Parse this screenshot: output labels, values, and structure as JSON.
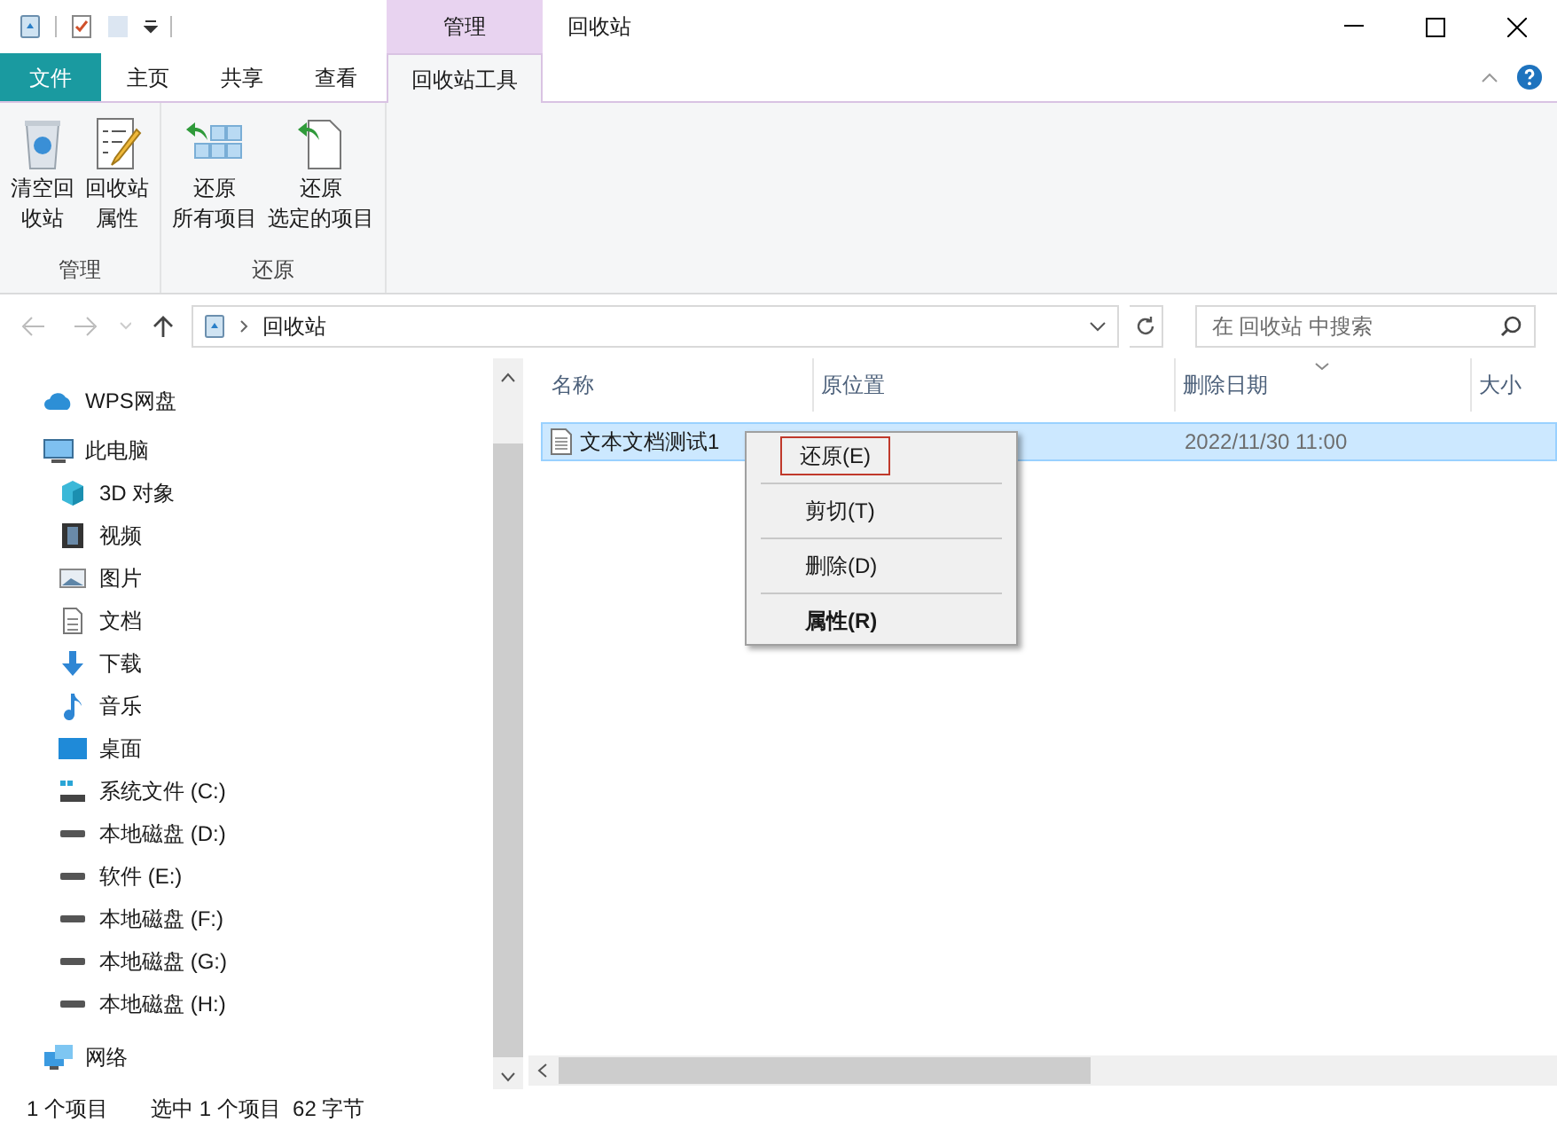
{
  "window": {
    "title": "回收站",
    "contextual_group": "管理"
  },
  "tabs": [
    {
      "label": "文件",
      "kind": "file",
      "selected": false
    },
    {
      "label": "主页",
      "kind": "normal",
      "selected": false
    },
    {
      "label": "共享",
      "kind": "normal",
      "selected": false
    },
    {
      "label": "查看",
      "kind": "normal",
      "selected": false
    },
    {
      "label": "回收站工具",
      "kind": "contextual",
      "selected": true
    }
  ],
  "ribbon": {
    "groups": [
      {
        "label": "管理",
        "buttons": [
          {
            "lines": [
              "清空回",
              "收站"
            ]
          },
          {
            "lines": [
              "回收站",
              "属性"
            ]
          }
        ]
      },
      {
        "label": "还原",
        "buttons": [
          {
            "lines": [
              "还原",
              "所有项目"
            ]
          },
          {
            "lines": [
              "还原",
              "选定的项目"
            ]
          }
        ]
      }
    ]
  },
  "address": {
    "path": "回收站",
    "search_placeholder": "在 回收站 中搜索"
  },
  "nav_pane": [
    {
      "label": "WPS网盘"
    },
    {
      "label": "此电脑",
      "children": [
        {
          "label": "3D 对象"
        },
        {
          "label": "视频"
        },
        {
          "label": "图片"
        },
        {
          "label": "文档"
        },
        {
          "label": "下载"
        },
        {
          "label": "音乐"
        },
        {
          "label": "桌面"
        },
        {
          "label": "系统文件 (C:)"
        },
        {
          "label": "本地磁盘 (D:)"
        },
        {
          "label": "软件 (E:)"
        },
        {
          "label": "本地磁盘 (F:)"
        },
        {
          "label": "本地磁盘 (G:)"
        },
        {
          "label": "本地磁盘 (H:)"
        }
      ]
    },
    {
      "label": "网络"
    }
  ],
  "table": {
    "columns": [
      "名称",
      "原位置",
      "删除日期",
      "大小"
    ],
    "rows": [
      {
        "name": "文本文档测试1",
        "date_deleted": "2022/11/30 11:00",
        "selected": true
      }
    ]
  },
  "context_menu": [
    {
      "label": "还原(E)",
      "highlighted": true,
      "bold": false
    },
    {
      "label": "剪切(T)",
      "highlighted": false,
      "bold": false
    },
    {
      "label": "删除(D)",
      "highlighted": false,
      "bold": false
    },
    {
      "label": "属性(R)",
      "highlighted": false,
      "bold": true
    }
  ],
  "status_bar": {
    "item_count": "1 个项目",
    "selection": "选中 1 个项目  62 字节"
  }
}
